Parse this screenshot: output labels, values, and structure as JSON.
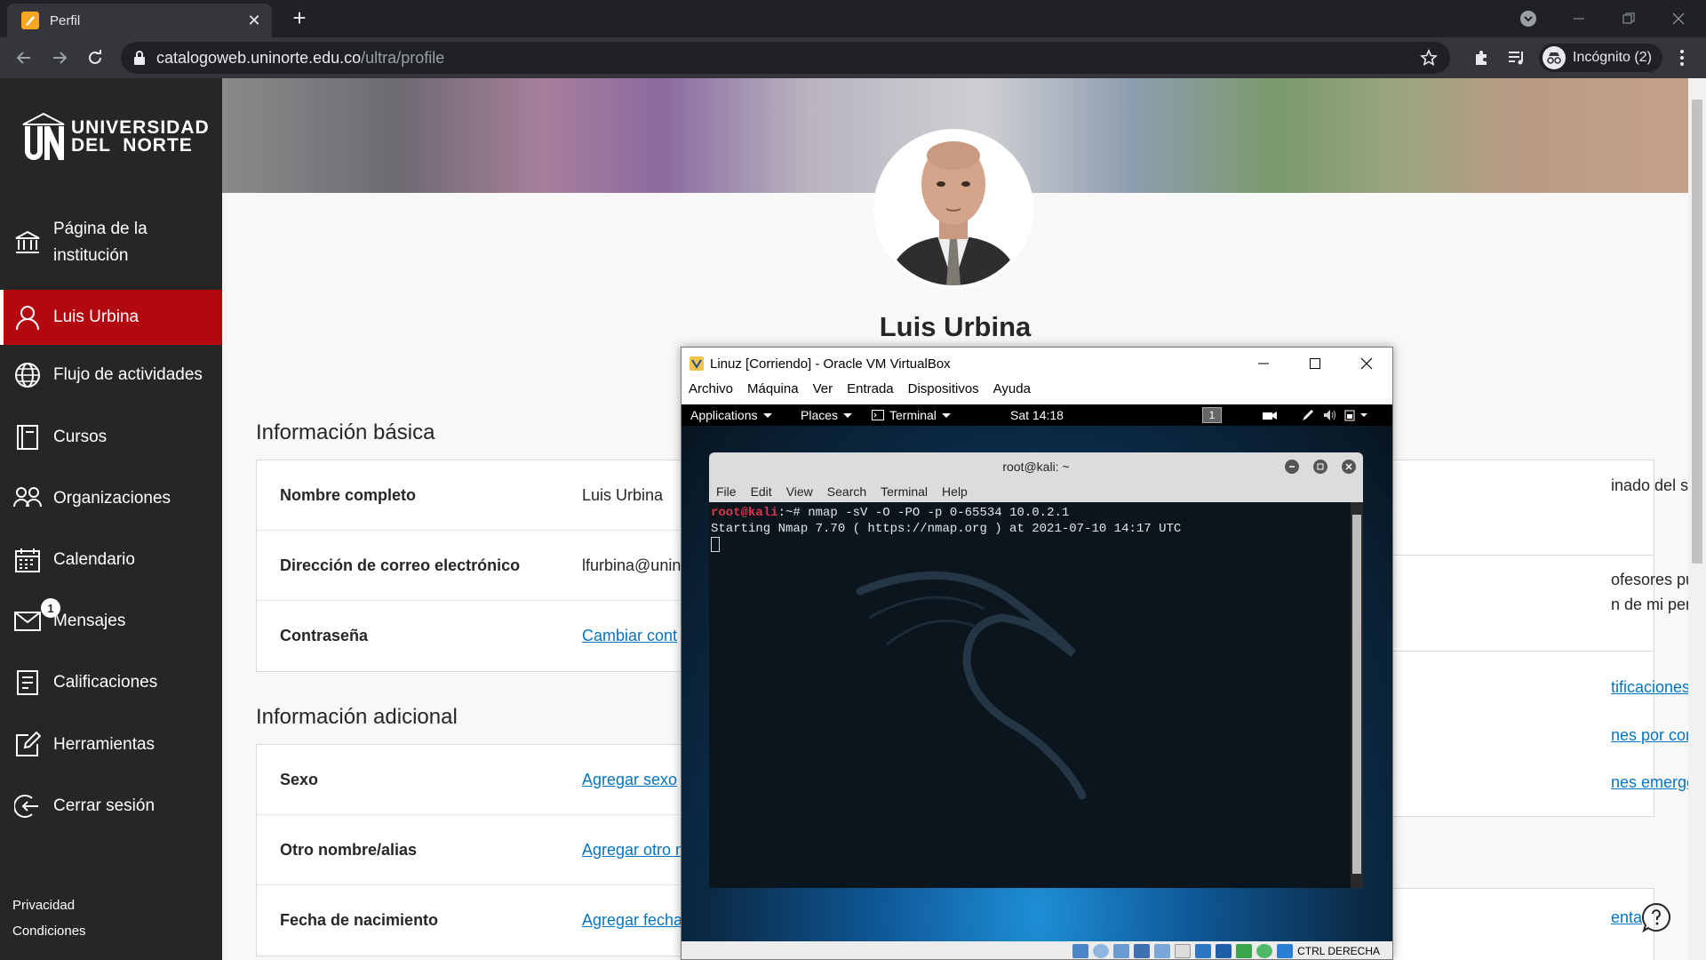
{
  "browser": {
    "tab_title": "Perfil",
    "url_host": "catalogoweb.uninorte.edu.co",
    "url_path": "/ultra/profile",
    "incognito_label": "Incógnito (2)"
  },
  "sidebar": {
    "logo_line1": "UNIVERSIDAD",
    "logo_line2": "DEL  NORTE",
    "items": [
      {
        "label": "Página de la institución",
        "icon": "institution-icon"
      },
      {
        "label": "Luis Urbina",
        "icon": "user-icon",
        "active": true
      },
      {
        "label": "Flujo de actividades",
        "icon": "globe-icon"
      },
      {
        "label": "Cursos",
        "icon": "book-icon"
      },
      {
        "label": "Organizaciones",
        "icon": "people-icon"
      },
      {
        "label": "Calendario",
        "icon": "calendar-icon"
      },
      {
        "label": "Mensajes",
        "icon": "mail-icon",
        "badge": "1"
      },
      {
        "label": "Calificaciones",
        "icon": "grades-icon"
      },
      {
        "label": "Herramientas",
        "icon": "tools-icon"
      },
      {
        "label": "Cerrar sesión",
        "icon": "logout-icon"
      }
    ],
    "footer": {
      "privacy": "Privacidad",
      "terms": "Condiciones"
    }
  },
  "profile": {
    "name": "Luis Urbina",
    "basic_title": "Información básica",
    "basic_rows": [
      {
        "label": "Nombre completo",
        "value": "Luis Urbina"
      },
      {
        "label": "Dirección de correo electrónico",
        "value": "lfurbina@unin"
      },
      {
        "label": "Contraseña",
        "link": "Cambiar cont"
      }
    ],
    "additional_title": "Información adicional",
    "additional_rows": [
      {
        "label": "Sexo",
        "link": "Agregar sexo"
      },
      {
        "label": "Otro nombre/alias",
        "link": "Agregar otro n"
      },
      {
        "label": "Fecha de nacimiento",
        "link": "Agregar fecha"
      }
    ],
    "right": {
      "language_text": "inado del sistema (Español",
      "privacy_text1": "ofesores pueden ver la",
      "privacy_text2": "n de mi perfil",
      "notif_link1": "tificaciones",
      "notif_link2": "nes por correo electrónico",
      "notif_link3": "nes emergentes",
      "bottom_link": "enta"
    }
  },
  "vbox": {
    "title": "Linuz [Corriendo] - Oracle VM VirtualBox",
    "menu": [
      "Archivo",
      "Máquina",
      "Ver",
      "Entrada",
      "Dispositivos",
      "Ayuda"
    ],
    "gnome": {
      "applications": "Applications",
      "places": "Places",
      "terminal": "Terminal",
      "clock": "Sat 14:18",
      "workspace": "1"
    },
    "terminal": {
      "title": "root@kali: ~",
      "menu": [
        "File",
        "Edit",
        "View",
        "Search",
        "Terminal",
        "Help"
      ],
      "prompt_user": "root@kali",
      "prompt_rest": ":~# nmap -sV -O -PO -p 0-65534 10.0.2.1",
      "output": "Starting Nmap 7.70 ( https://nmap.org ) at 2021-07-10 14:17 UTC"
    },
    "status": "CTRL DERECHA"
  }
}
